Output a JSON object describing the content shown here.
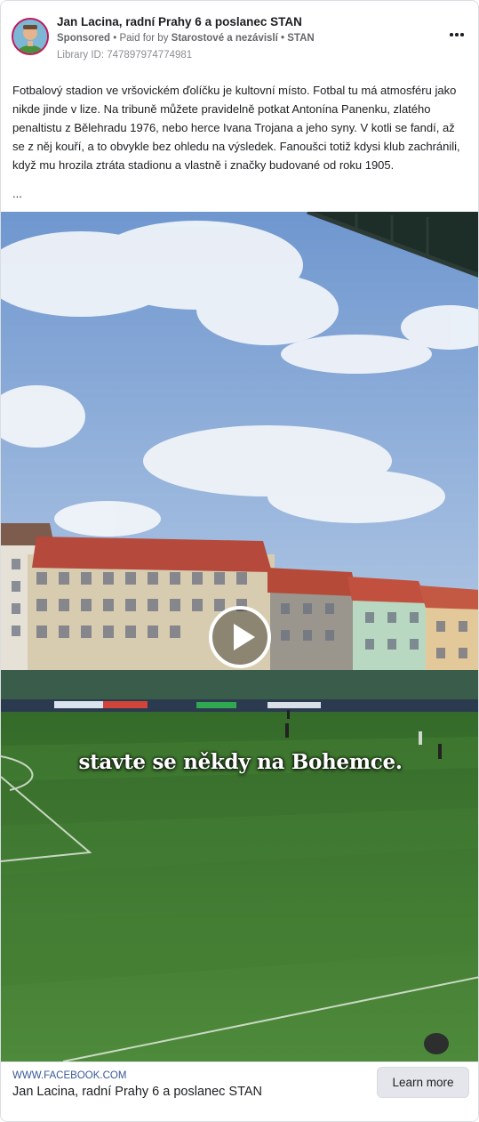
{
  "advertiser": {
    "name": "Jan Lacina, radní Prahy 6 a poslanec STAN",
    "sponsored": "Sponsored",
    "paid_for_prefix": " • Paid for by ",
    "payer": "Starostové a nezávislí • STAN",
    "library_id": "Library ID: 747897974774981"
  },
  "post": {
    "text": "Fotbalový stadion ve vršovickém ďolíčku je kultovní místo. Fotbal tu má atmosféru jako nikde jinde v lize. Na tribuně můžete pravidelně potkat Antonína Panenku, zlatého penaltistu z Bělehradu 1976, nebo herce Ivana Trojana a jeho syny. V kotli se fandí, až se z něj kouří, a to obvykle bez ohledu na výsledek. Fanoušci totiž kdysi klub zachránili, když mu hrozila ztráta stadionu a vlastně i značky budované od roku 1905.",
    "ellipsis": "..."
  },
  "media": {
    "caption": "stavte se někdy na Bohemce.",
    "play_icon": "play-icon"
  },
  "footer": {
    "domain": "WWW.FACEBOOK.COM",
    "title": "Jan Lacina, radní Prahy 6 a poslanec STAN",
    "cta_label": "Learn more"
  },
  "colors": {
    "sky": "#7fa6d6",
    "pitch": "#3f7a31",
    "link": "#385898",
    "avatar_ring": "#c2185b"
  }
}
